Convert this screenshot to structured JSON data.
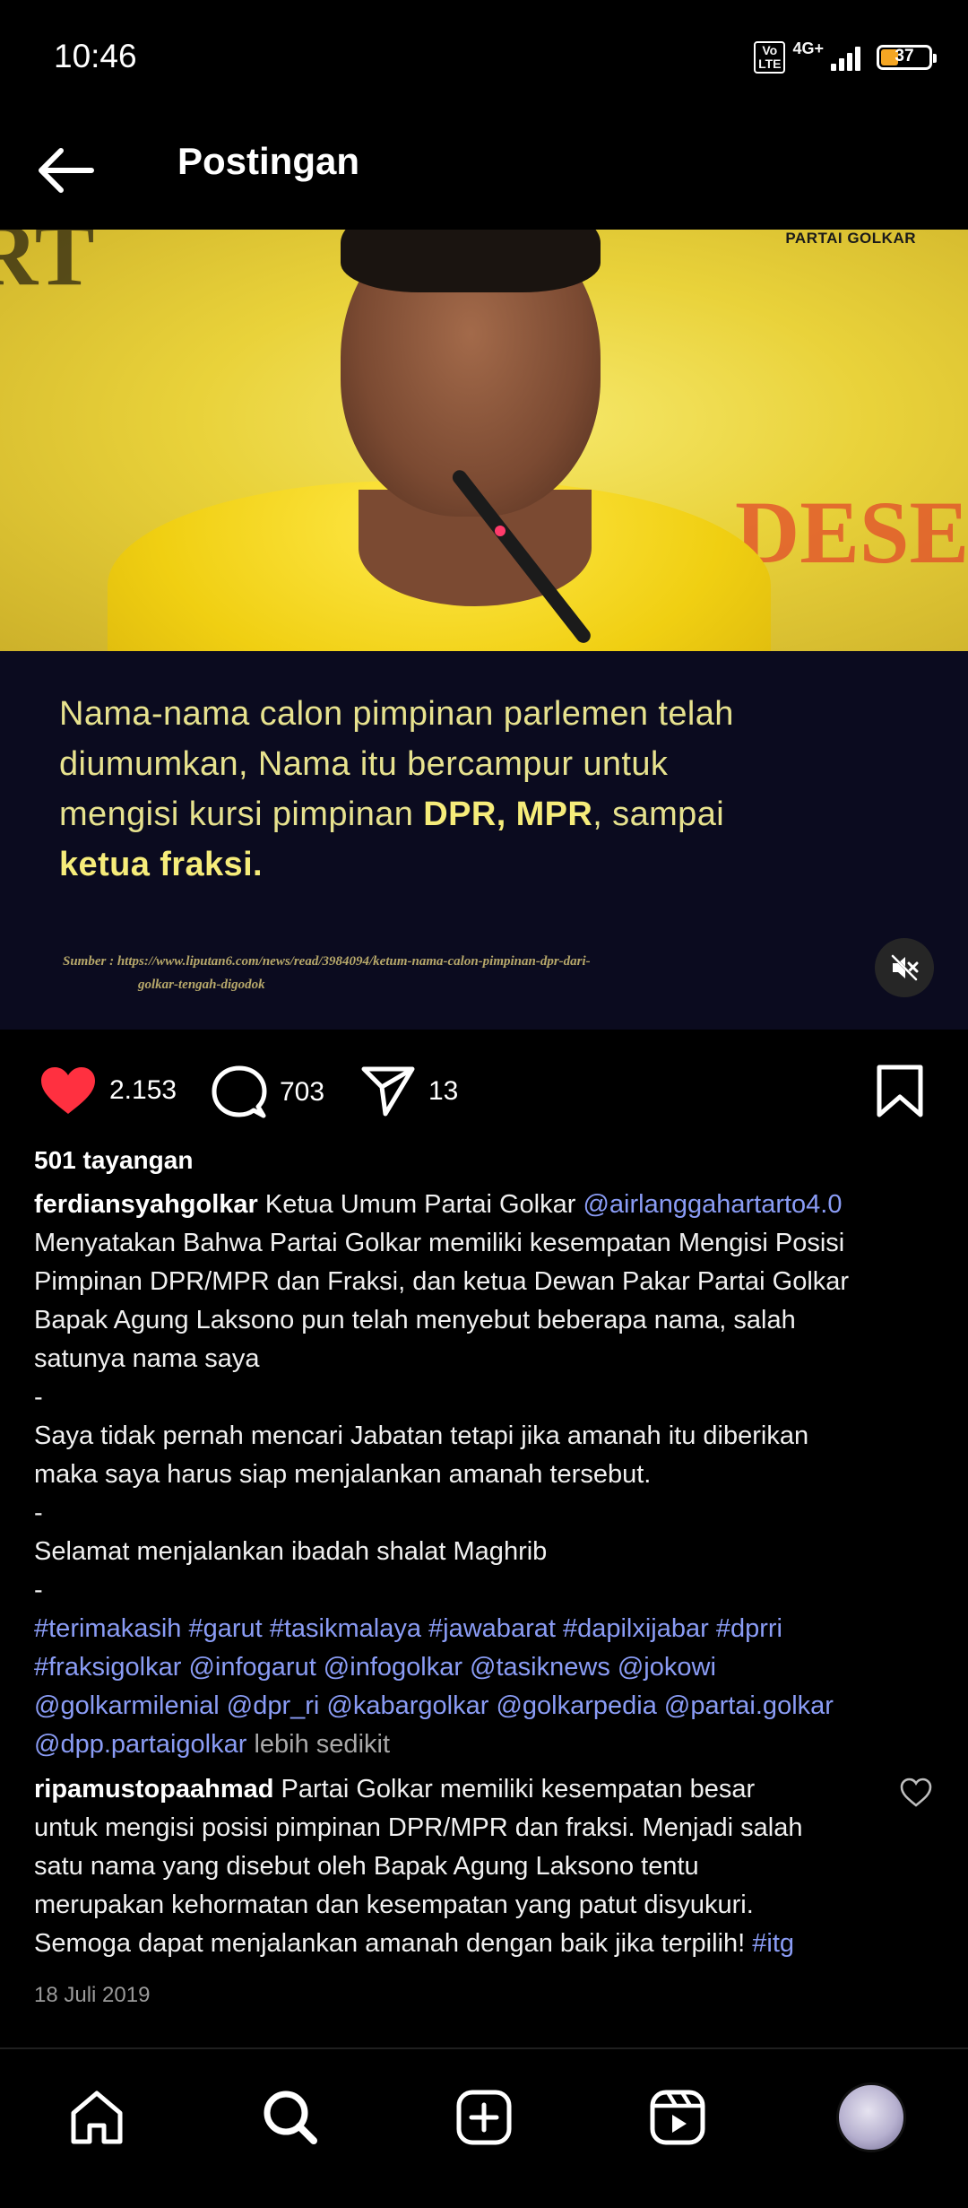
{
  "status_bar": {
    "time": "10:46",
    "volte": "Vo LTE",
    "network": "4G+",
    "battery": "37",
    "battery_fill_percent": 37
  },
  "header": {
    "title": "Postingan",
    "back_icon": "arrow-left-icon"
  },
  "media": {
    "party_tag": "PARTAI GOLKAR",
    "wall_text": "DESEN",
    "caption_lines": [
      "Nama-nama calon pimpinan parlemen telah",
      "diumumkan, Nama itu bercampur untuk",
      "mengisi kursi pimpinan ",
      "DPR, MPR",
      ", sampai",
      "ketua fraksi."
    ],
    "source_line1": "Sumber : https://www.liputan6.com/news/read/3984094/ketum-nama-calon-pimpinan-dpr-dari-",
    "source_line2": "golkar-tengah-digodok",
    "mute_icon": "speaker-muted-icon"
  },
  "actions": {
    "likes": "2.153",
    "comments": "703",
    "shares": "13",
    "like_color": "#ff3040"
  },
  "post": {
    "views": "501 tayangan",
    "username": "ferdiansyahgolkar",
    "intro": " Ketua Umum Partai Golkar ",
    "mention_main": "@airlanggahartarto4.0",
    "line1": "Menyatakan Bahwa Partai Golkar memiliki kesempatan Mengisi Posisi",
    "line2": "Pimpinan DPR/MPR dan Fraksi, dan ketua Dewan Pakar Partai Golkar",
    "line3": "Bapak Agung Laksono pun telah menyebut beberapa nama, salah",
    "line4": "satunya nama saya",
    "dash": "-",
    "line5": "Saya tidak pernah mencari Jabatan tetapi jika amanah itu diberikan",
    "line6": "maka saya harus siap menjalankan amanah tersebut.",
    "line7": "Selamat menjalankan ibadah shalat Maghrib",
    "tags1": "#terimakasih #garut #tasikmalaya #jawabarat #dapilxijabar #dprri",
    "tags2": "#fraksigolkar @infogarut @infogolkar @tasiknews @jokowi",
    "tags3": "@golkarmilenial @dpr_ri @kabargolkar @golkarpedia @partai.golkar",
    "tags4": "@dpp.partaigolkar",
    "less": " lebih sedikit"
  },
  "comment": {
    "username": "ripamustopaahmad",
    "text1": " Partai Golkar memiliki kesempatan besar",
    "text2": "untuk mengisi posisi pimpinan DPR/MPR dan fraksi. Menjadi salah",
    "text3": "satu nama yang disebut oleh Bapak Agung Laksono tentu",
    "text4": "merupakan kehormatan dan kesempatan yang patut disyukuri.",
    "text5": "Semoga dapat menjalankan amanah dengan baik jika terpilih! ",
    "tag": "#itg"
  },
  "date": "18 Juli 2019",
  "bottom_nav": {
    "items": [
      "home-icon",
      "search-icon",
      "create-icon",
      "reels-icon",
      "profile-avatar"
    ]
  }
}
